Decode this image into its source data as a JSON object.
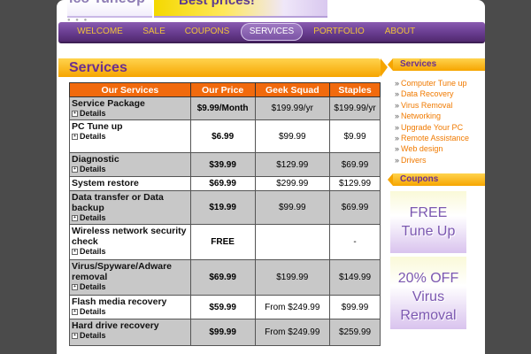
{
  "banner": {
    "left_text": "ico TuneUp",
    "right_text": "Best prices!"
  },
  "nav": [
    {
      "label": "WELCOME",
      "active": false
    },
    {
      "label": "SALE",
      "active": false
    },
    {
      "label": "COUPONS",
      "active": false
    },
    {
      "label": "SERVICES",
      "active": true
    },
    {
      "label": "PORTFOLIO",
      "active": false
    },
    {
      "label": "ABOUT",
      "active": false
    }
  ],
  "page_title": "Services",
  "table": {
    "headers": [
      "Our Services",
      "Our Price",
      "Geek Squad",
      "Staples"
    ],
    "details_label": "Details",
    "rows": [
      {
        "name": "Service Package",
        "ours": "$9.99/Month",
        "geek": "$199.99/yr",
        "staples": "$199.99/yr",
        "details": true
      },
      {
        "name": "PC Tune up",
        "ours": "$6.99",
        "geek": "$99.99",
        "staples": "$9.99",
        "details": true
      },
      {
        "name": "Diagnostic",
        "ours": "$39.99",
        "geek": "$129.99",
        "staples": "$69.99",
        "details": true
      },
      {
        "name": "System restore",
        "ours": "$69.99",
        "geek": "$299.99",
        "staples": "$129.99",
        "details": false
      },
      {
        "name": "Data transfer or Data backup",
        "ours": "$19.99",
        "geek": "$99.99",
        "staples": "$69.99",
        "details": true
      },
      {
        "name": "Wireless network security check",
        "ours": "FREE",
        "geek": "",
        "staples": "-",
        "details": true
      },
      {
        "name": "Virus/Spyware/Adware removal",
        "ours": "$69.99",
        "geek": "$199.99",
        "staples": "$149.99",
        "details": true
      },
      {
        "name": "Flash media recovery",
        "ours": "$59.99",
        "geek": "From $249.99",
        "staples": "$99.99",
        "details": true
      },
      {
        "name": "Hard drive recovery",
        "ours": "$99.99",
        "geek": "From $249.99",
        "staples": "$259.99",
        "details": true
      }
    ]
  },
  "sidebar": {
    "services_title": "Services",
    "bullet": "»",
    "links": [
      "Computer Tune up",
      "Data Recovery",
      "Virus Removal",
      "Networking",
      "Upgrade Your PC",
      "Remote Assistance",
      "Web design",
      "Drivers"
    ],
    "coupons_title": "Coupons",
    "coupons": [
      {
        "line1": "FREE",
        "line2": "Tune Up"
      },
      {
        "line1": "20% OFF",
        "line2": "Virus",
        "line3": "Removal"
      }
    ]
  },
  "colors": {
    "accent_orange": "#f16a0d",
    "nav_purple": "#6b3f93",
    "link_orange": "#f07a00"
  }
}
